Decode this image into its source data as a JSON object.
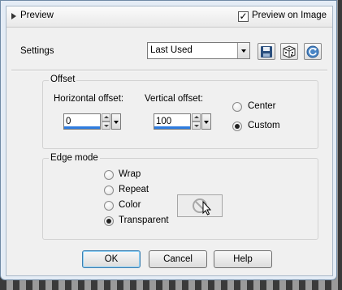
{
  "preview": {
    "label": "Preview",
    "preview_on_image_label": "Preview on Image",
    "preview_on_image_checked": true
  },
  "settings": {
    "label": "Settings",
    "preset_value": "Last Used"
  },
  "offset": {
    "title": "Offset",
    "horizontal_label": "Horizontal offset:",
    "horizontal_value": "0",
    "vertical_label": "Vertical offset:",
    "vertical_value": "100",
    "center_label": "Center",
    "custom_label": "Custom",
    "selected": "Custom"
  },
  "edge_mode": {
    "title": "Edge mode",
    "options": [
      "Wrap",
      "Repeat",
      "Color",
      "Transparent"
    ],
    "selected": "Transparent"
  },
  "buttons": {
    "ok": "OK",
    "cancel": "Cancel",
    "help": "Help"
  },
  "icons": [
    "chevron-right-icon",
    "save-preset-icon",
    "randomize-icon",
    "reset-icon",
    "no-color-icon",
    "cursor-arrow-icon"
  ],
  "colors": {
    "accent": "#2f7de0",
    "ok_border": "#3c7fb1"
  }
}
